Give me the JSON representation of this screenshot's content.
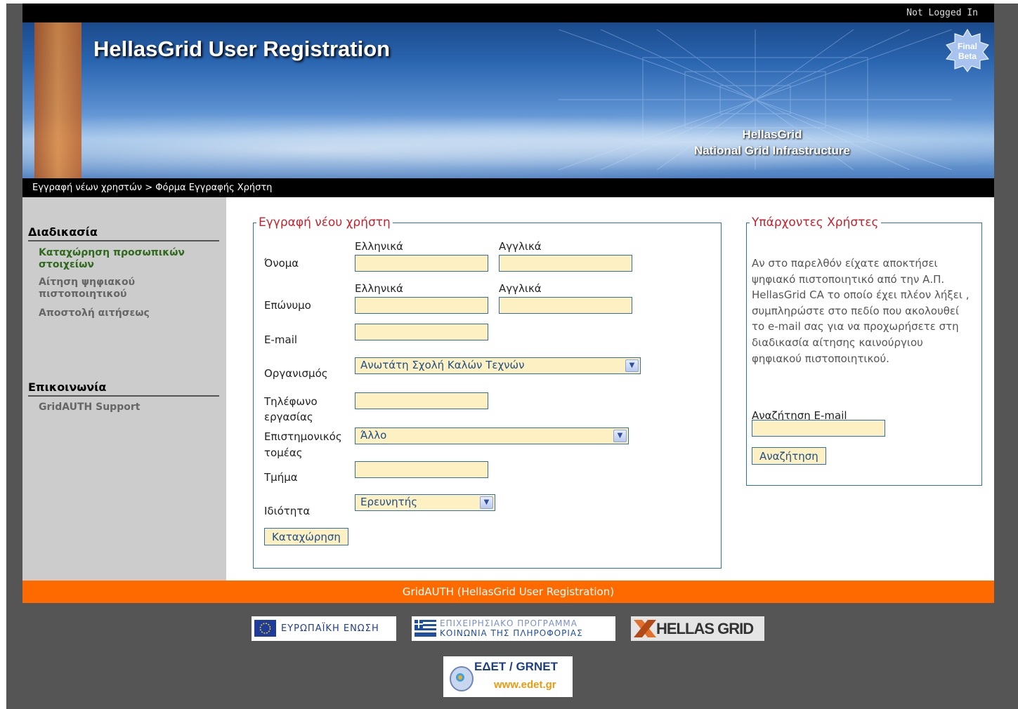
{
  "header": {
    "login_status": "Not Logged In",
    "title": "HellasGrid User Registration",
    "subtitle_line1": "HellasGrid",
    "subtitle_line2": "National Grid Infrastructure",
    "badge_line1": "Final",
    "badge_line2": "Beta"
  },
  "breadcrumb": "Εγγραφή νέων χρηστών > Φόρμα Εγγραφής Χρήστη",
  "sidebar": {
    "process_heading": "Διαδικασία",
    "items": [
      {
        "label": "Καταχώρηση προσωπικών στοιχείων",
        "active": true
      },
      {
        "label": "Αίτηση ψηφιακού πιστοποιητικού",
        "active": false
      },
      {
        "label": "Αποστολή αιτήσεως",
        "active": false
      }
    ],
    "contact_heading": "Επικοινωνία",
    "contact_item": "GridAUTH Support"
  },
  "form": {
    "legend": "Εγγραφή νέου χρήστη",
    "greek_label": "Ελληνικά",
    "english_label": "Αγγλικά",
    "first_name": "Όνομα",
    "last_name": "Επώνυμο",
    "email": "E-mail",
    "organization": "Οργανισμός",
    "organization_value": "Ανωτάτη Σχολή Καλών Τεχνών",
    "phone_line1": "Τηλέφωνο",
    "phone_line2": "εργασίας",
    "field_line1": "Επιστημονικός",
    "field_line2": "τομέας",
    "field_value": "Άλλο",
    "department": "Τμήμα",
    "role": "Ιδιότητα",
    "role_value": "Ερευνητής",
    "submit": "Καταχώρηση"
  },
  "existing": {
    "legend": "Υπάρχοντες Χρήστες",
    "text": "Αν στο παρελθόν είχατε αποκτήσει ψηφιακό πιστοποιητικό από την Α.Π. HellasGrid CA το οποίο έχει πλέον λήξει , συμπληρώστε στο πεδίο που ακολουθεί το e-mail σας για να προχωρήσετε στη διαδικασία αίτησης καινούργιου φηφιακού πιστοποιητικού.",
    "search_label": "Αναζήτηση E-mail",
    "search_button": "Αναζήτηση"
  },
  "footer": {
    "text": "GridAUTH (HellasGrid User Registration)",
    "logo_eu": "ΕΥΡΩΠΑΪΚΗ ΕΝΩΣΗ",
    "logo_info_line1": "ΕΠΙΧΕΙΡΗΣΙΑΚΟ ΠΡΟΓΡΑΜΜΑ",
    "logo_info_line2": "ΚΟΙΝΩΝΙΑ ΤΗΣ ΠΛΗΡΟΦΟΡΙΑΣ",
    "logo_hellasgrid": "HELLAS GRID",
    "logo_edet_line1": "ΕΔΕΤ / GRNET",
    "logo_edet_line2": "www.edet.gr"
  },
  "colors": {
    "accent": "#ff6a00",
    "legend": "#c8212b",
    "field_bg": "#fdf0c2",
    "border": "#2f6dab"
  }
}
